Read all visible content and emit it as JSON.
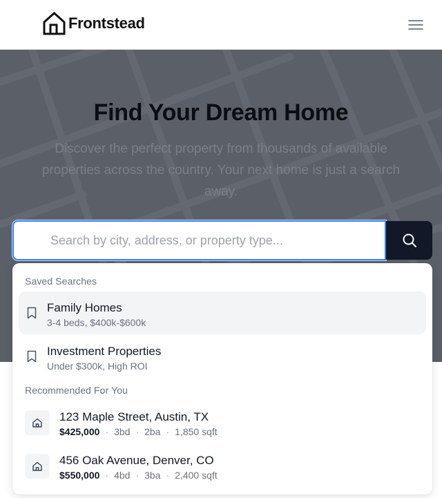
{
  "header": {
    "brand": "Frontstead",
    "logo_icon": "house-outline-icon",
    "menu_icon": "hamburger-menu-icon"
  },
  "hero": {
    "title": "Find Your Dream Home",
    "subtitle": "Discover the perfect property from thousands of available properties across the country. Your next home is just a search away.",
    "background_color": "#5b5f68"
  },
  "search": {
    "placeholder": "Search by city, address, or property type...",
    "value": "",
    "button_icon": "search-icon",
    "focus_color": "#3b82f6"
  },
  "dropdown": {
    "saved_label": "Saved Searches",
    "saved": [
      {
        "title": "Family Homes",
        "subtitle": "3-4 beds, $400k-$600k",
        "icon": "bookmark-icon"
      },
      {
        "title": "Investment Properties",
        "subtitle": "Under $300k, High ROI",
        "icon": "bookmark-icon"
      }
    ],
    "recommended_label": "Recommended For You",
    "recommended": [
      {
        "address": "123 Maple Street, Austin, TX",
        "price": "$425,000",
        "beds": "3bd",
        "baths": "2ba",
        "sqft": "1,850 sqft",
        "icon": "house-icon"
      },
      {
        "address": "456 Oak Avenue, Denver, CO",
        "price": "$550,000",
        "beds": "4bd",
        "baths": "3ba",
        "sqft": "2,400 sqft",
        "icon": "house-icon"
      }
    ]
  },
  "colors": {
    "primary_dark": "#111827",
    "muted_text": "#6b7280",
    "highlight_bg": "#f3f4f6"
  }
}
